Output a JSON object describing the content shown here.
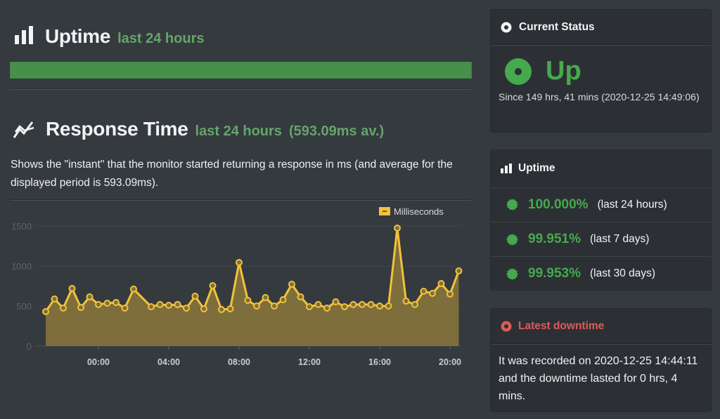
{
  "uptime_section": {
    "icon": "bar-chart-icon",
    "title": "Uptime",
    "subtitle": "last 24 hours",
    "bar_uptime_fraction": 1.0,
    "bar_color": "#46904a"
  },
  "response_section": {
    "icon": "line-trend-icon",
    "title": "Response Time",
    "subtitle": "last 24 hours",
    "average": "(593.09ms av.)",
    "description": "Shows the \"instant\" that the monitor started returning a response in ms (and average for the displayed period is 593.09ms)."
  },
  "chart_data": {
    "type": "area",
    "title": "",
    "xlabel": "",
    "ylabel": "",
    "legend": {
      "label": "Milliseconds",
      "position": "top-right",
      "color": "#f2c23a"
    },
    "ylim": [
      0,
      1500
    ],
    "y_ticks": [
      "0",
      "500",
      "1000",
      "1500"
    ],
    "y_tick_values": [
      0,
      500,
      1000,
      1500
    ],
    "x_ticks": [
      "00:00",
      "04:00",
      "08:00",
      "12:00",
      "16:00",
      "20:00"
    ],
    "x_tick_hours": [
      0,
      4,
      8,
      12,
      16,
      20
    ],
    "x_range_hours": [
      -3.5,
      21.0
    ],
    "grid": true,
    "series": [
      {
        "name": "Milliseconds",
        "color": "#f2c23a",
        "fill": "#7f6f3c",
        "points": [
          {
            "h": -3.0,
            "v": 430
          },
          {
            "h": -2.5,
            "v": 588
          },
          {
            "h": -2.0,
            "v": 474
          },
          {
            "h": -1.5,
            "v": 719
          },
          {
            "h": -1.0,
            "v": 482
          },
          {
            "h": -0.5,
            "v": 614
          },
          {
            "h": 0.0,
            "v": 518
          },
          {
            "h": 0.5,
            "v": 535
          },
          {
            "h": 1.0,
            "v": 544
          },
          {
            "h": 1.5,
            "v": 474
          },
          {
            "h": 2.0,
            "v": 711
          },
          {
            "h": 3.0,
            "v": 491
          },
          {
            "h": 3.5,
            "v": 518
          },
          {
            "h": 4.0,
            "v": 509
          },
          {
            "h": 4.5,
            "v": 518
          },
          {
            "h": 5.0,
            "v": 474
          },
          {
            "h": 5.5,
            "v": 623
          },
          {
            "h": 6.0,
            "v": 465
          },
          {
            "h": 6.5,
            "v": 754
          },
          {
            "h": 7.0,
            "v": 456
          },
          {
            "h": 7.5,
            "v": 465
          },
          {
            "h": 8.0,
            "v": 1044
          },
          {
            "h": 8.5,
            "v": 570
          },
          {
            "h": 9.0,
            "v": 500
          },
          {
            "h": 9.5,
            "v": 605
          },
          {
            "h": 10.0,
            "v": 500
          },
          {
            "h": 10.5,
            "v": 579
          },
          {
            "h": 11.0,
            "v": 772
          },
          {
            "h": 11.5,
            "v": 614
          },
          {
            "h": 12.0,
            "v": 491
          },
          {
            "h": 12.5,
            "v": 518
          },
          {
            "h": 13.0,
            "v": 474
          },
          {
            "h": 13.5,
            "v": 553
          },
          {
            "h": 14.0,
            "v": 491
          },
          {
            "h": 14.5,
            "v": 518
          },
          {
            "h": 15.0,
            "v": 518
          },
          {
            "h": 15.5,
            "v": 518
          },
          {
            "h": 16.0,
            "v": 500
          },
          {
            "h": 16.5,
            "v": 500
          },
          {
            "h": 17.0,
            "v": 1474
          },
          {
            "h": 17.5,
            "v": 561
          },
          {
            "h": 18.0,
            "v": 518
          },
          {
            "h": 18.5,
            "v": 684
          },
          {
            "h": 19.0,
            "v": 658
          },
          {
            "h": 19.5,
            "v": 781
          },
          {
            "h": 20.0,
            "v": 649
          },
          {
            "h": 20.5,
            "v": 939
          }
        ]
      }
    ]
  },
  "current_status": {
    "header_icon": "radio-dot-icon",
    "header": "Current Status",
    "state_icon": "status-up-icon",
    "state": "Up",
    "state_color": "#46a94d",
    "since": "Since 149 hrs, 41 mins (2020-12-25 14:49:06)"
  },
  "uptime_card": {
    "header_icon": "bar-chart-icon",
    "header": "Uptime",
    "rows": [
      {
        "icon": "badge-icon",
        "percent": "100.000%",
        "period": "(last 24 hours)"
      },
      {
        "icon": "badge-icon",
        "percent": "99.951%",
        "period": "(last 7 days)"
      },
      {
        "icon": "badge-icon",
        "percent": "99.953%",
        "period": "(last 30 days)"
      }
    ]
  },
  "latest_downtime": {
    "header_icon": "radio-dot-icon",
    "header": "Latest downtime",
    "header_color": "#e05a5a",
    "text": "It was recorded on 2020-12-25 14:44:11 and the downtime lasted for 0 hrs, 4 mins."
  }
}
